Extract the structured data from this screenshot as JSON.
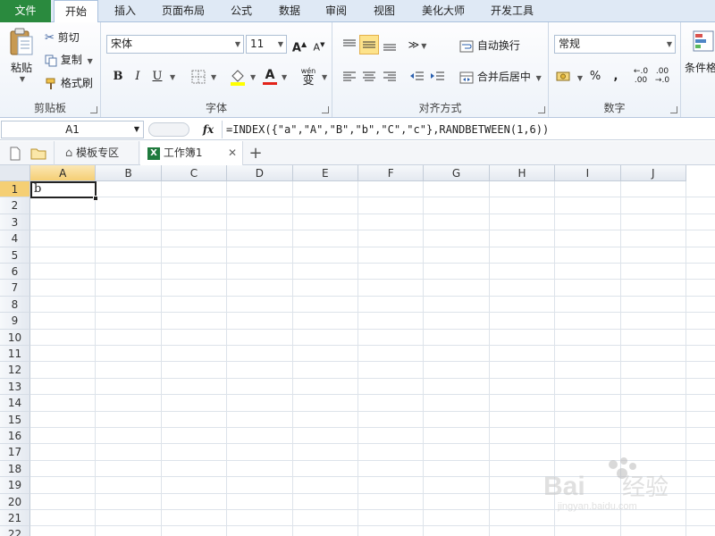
{
  "tabs": [
    "文件",
    "开始",
    "插入",
    "页面布局",
    "公式",
    "数据",
    "审阅",
    "视图",
    "美化大师",
    "开发工具"
  ],
  "clipboard": {
    "paste_label": "粘贴",
    "cut_label": "剪切",
    "copy_label": "复制",
    "format_painter_label": "格式刷",
    "group_label": "剪贴板"
  },
  "font": {
    "name": "宋体",
    "size": "11",
    "bold": "B",
    "italic": "I",
    "underline": "U",
    "grow": "A",
    "shrink": "A",
    "wen": "wén",
    "wen_char": "变",
    "group_label": "字体"
  },
  "alignment": {
    "wrap_text_label": "自动换行",
    "merge_center_label": "合并后居中",
    "group_label": "对齐方式"
  },
  "number": {
    "format": "常规",
    "percent": "%",
    "comma": ",",
    "group_label": "数字"
  },
  "styles": {
    "cond_format_label": "条件格"
  },
  "formula_bar": {
    "name_box": "A1",
    "fx_label": "fx",
    "formula": "=INDEX({\"a\",\"A\",\"B\",\"b\",\"C\",\"c\"},RANDBETWEEN(1,6))"
  },
  "workbook_tabs": {
    "templates_label": "模板专区",
    "workbook_label": "工作簿1",
    "add_label": "+"
  },
  "sheet": {
    "columns": [
      "A",
      "B",
      "C",
      "D",
      "E",
      "F",
      "G",
      "H",
      "I",
      "J"
    ],
    "rows": [
      "1",
      "2",
      "3",
      "4",
      "5",
      "6",
      "7",
      "8",
      "9",
      "10",
      "11",
      "12",
      "13",
      "14",
      "15",
      "16",
      "17",
      "18",
      "19",
      "20",
      "21",
      "22"
    ],
    "selected_cell_value": "b"
  },
  "watermark": {
    "brand_text": "Bai",
    "brand_text2": "经验",
    "brand_url": "jingyan.baidu.com"
  },
  "colors": {
    "file_tab": "#2a8a3e",
    "selected_header": "#f5cf74",
    "selected_tool": "#fde38b",
    "font_color_red": "#e2231a",
    "highlight_yellow": "#ffff00"
  }
}
